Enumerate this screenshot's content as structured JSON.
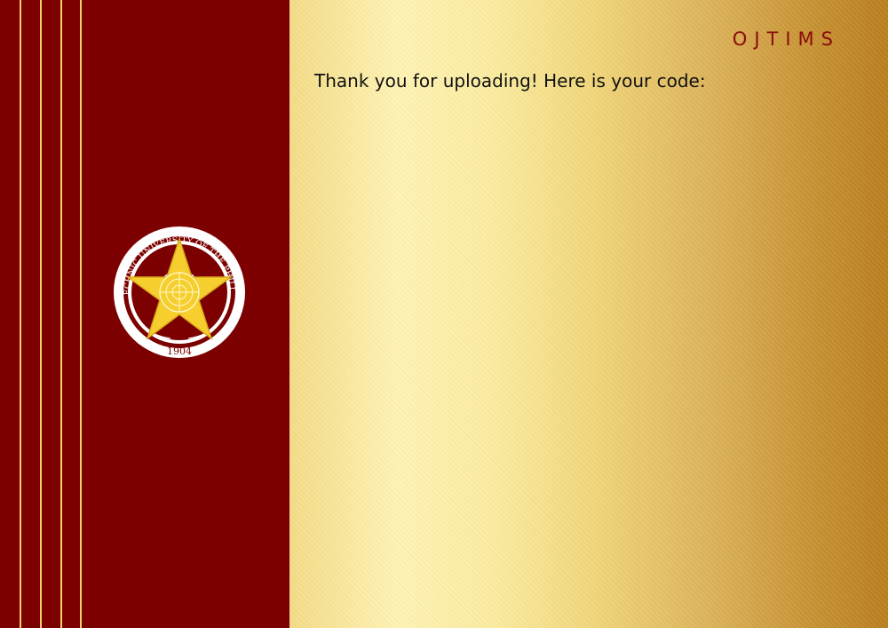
{
  "header": {
    "brand": "OJTIMS"
  },
  "main": {
    "message": "Thank you for uploading! Here is your code:"
  },
  "seal": {
    "text": "POLYTECHNIC UNIVERSITY OF THE PHILIPPINES",
    "year": "1904",
    "icon": "university-seal-icon"
  },
  "colors": {
    "sidebar": "#7d0000",
    "stripe": "#f2d26a",
    "brand": "#8a0c0c",
    "gold_light": "#fff3b3",
    "gold_dark": "#b97e1e"
  }
}
